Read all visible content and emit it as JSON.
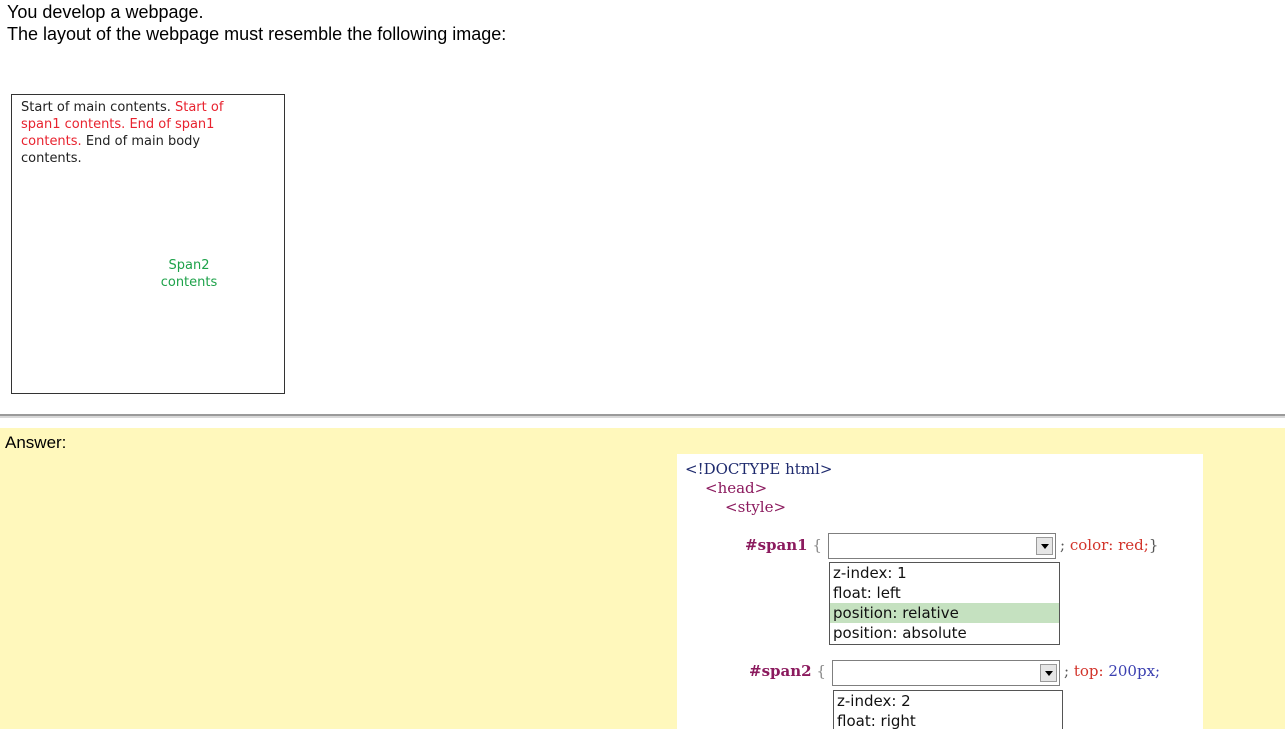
{
  "question": {
    "line1": "You develop a webpage.",
    "line2": "The layout of the webpage must resemble the following image:"
  },
  "preview": {
    "main_start": "Start of main contents.",
    "span1_text": "Start of span1 contents. End of span1 contents.",
    "main_end": "End of main body contents.",
    "span2_text": "Span2 contents",
    "colors": {
      "span1": "#e8232f",
      "span2": "#1ea24a"
    }
  },
  "answer": {
    "label": "Answer:",
    "code": {
      "doctype": "<!DOCTYPE html>",
      "head_open": "<head>",
      "style_open": "<style>",
      "rule1": {
        "selector": "#span1",
        "open_brace": "{",
        "semicolon": ";",
        "prop": "color:",
        "value": "red;",
        "close_brace": "}"
      },
      "rule2": {
        "selector": "#span2",
        "open_brace": "{",
        "semicolon": ";",
        "prop": "top:",
        "value": "200px;"
      }
    },
    "dropdown1": {
      "selected_value": "",
      "options": [
        "z-index: 1",
        "float: left",
        "position: relative",
        "position: absolute"
      ],
      "highlighted": "position: relative"
    },
    "dropdown2": {
      "selected_value": "",
      "options": [
        "z-index: 2",
        "float: right"
      ]
    }
  }
}
